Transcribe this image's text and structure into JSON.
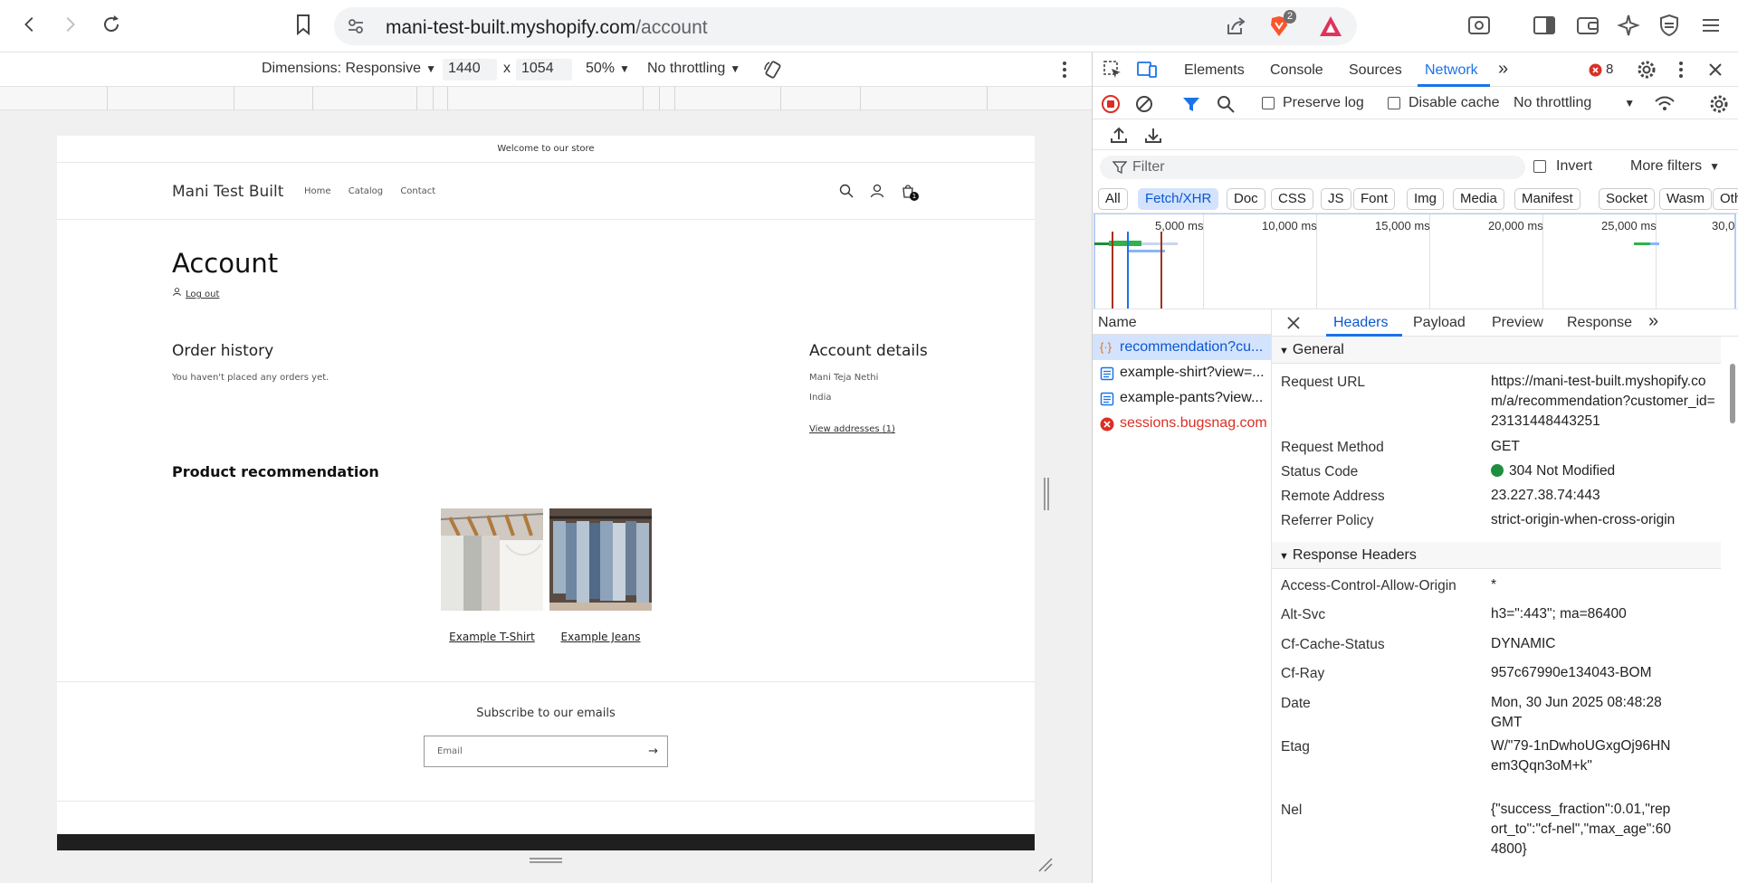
{
  "browser": {
    "url_domain": "mani-test-built.myshopify.com",
    "url_path": "/account",
    "brave_badge": "2"
  },
  "device_toolbar": {
    "dimensions_label": "Dimensions: Responsive",
    "width": "1440",
    "times": "x",
    "height": "1054",
    "zoom": "50%",
    "throttling": "No throttling"
  },
  "shop": {
    "announcement": "Welcome to our store",
    "logo": "Mani Test Built",
    "menu": [
      "Home",
      "Catalog",
      "Contact"
    ],
    "cart_count": "1",
    "page_title": "Account",
    "logout": "Log out",
    "order_history_title": "Order history",
    "order_history_text": "You haven't placed any orders yet.",
    "account_details_title": "Account details",
    "customer_name": "Mani Teja Nethi",
    "customer_country": "India",
    "view_addresses": "View addresses (1)",
    "recommendation_title": "Product recommendation",
    "products": [
      {
        "name": "Example T-Shirt"
      },
      {
        "name": "Example Jeans"
      }
    ],
    "subscribe_title": "Subscribe to our emails",
    "email_placeholder": "Email"
  },
  "devtools": {
    "tabs": [
      "Elements",
      "Console",
      "Sources",
      "Network"
    ],
    "active_tab": "Network",
    "error_count": "8",
    "preserve_log": "Preserve log",
    "disable_cache": "Disable cache",
    "throttling": "No throttling",
    "filter_placeholder": "Filter",
    "invert": "Invert",
    "more_filters": "More filters",
    "type_filters": [
      "All",
      "Fetch/XHR",
      "Doc",
      "CSS",
      "JS",
      "Font",
      "Img",
      "Media",
      "Manifest",
      "Socket",
      "Wasm",
      "Other"
    ],
    "active_type": "Fetch/XHR",
    "timeline_labels": [
      "5,000 ms",
      "10,000 ms",
      "15,000 ms",
      "20,000 ms",
      "25,000 ms",
      "30,0"
    ],
    "name_header": "Name",
    "requests": [
      {
        "name": "recommendation?cu...",
        "kind": "xhr",
        "selected": true
      },
      {
        "name": "example-shirt?view=...",
        "kind": "doc"
      },
      {
        "name": "example-pants?view...",
        "kind": "doc"
      },
      {
        "name": "sessions.bugsnag.com",
        "kind": "error"
      }
    ],
    "detail_tabs": [
      "Headers",
      "Payload",
      "Preview",
      "Response"
    ],
    "active_detail_tab": "Headers",
    "general_title": "General",
    "general": [
      {
        "k": "Request URL",
        "v": "https://mani-test-built.myshopify.com/a/recommendation?customer_id=23131448443251"
      },
      {
        "k": "Request Method",
        "v": "GET"
      },
      {
        "k": "Status Code",
        "v": "304 Not Modified"
      },
      {
        "k": "Remote Address",
        "v": "23.227.38.74:443"
      },
      {
        "k": "Referrer Policy",
        "v": "strict-origin-when-cross-origin"
      }
    ],
    "response_title": "Response Headers",
    "response": [
      {
        "k": "Access-Control-Allow-Origin",
        "v": "*"
      },
      {
        "k": "Alt-Svc",
        "v": "h3=\":443\"; ma=86400"
      },
      {
        "k": "Cf-Cache-Status",
        "v": "DYNAMIC"
      },
      {
        "k": "Cf-Ray",
        "v": "957c67990e134043-BOM"
      },
      {
        "k": "Date",
        "v": "Mon, 30 Jun 2025 08:48:28 GMT"
      },
      {
        "k": "Etag",
        "v": "W/\"79-1nDwhoUGxgOj96HNem3Qqn3oM+k\""
      },
      {
        "k": "Nel",
        "v": "{\"success_fraction\":0.01,\"report_to\":\"cf-nel\",\"max_age\":604800}"
      }
    ],
    "colors": {
      "accent": "#1a73e8",
      "selected_bg": "#d3e3fd",
      "error": "#d93025",
      "ok": "#1e8e3e"
    }
  }
}
